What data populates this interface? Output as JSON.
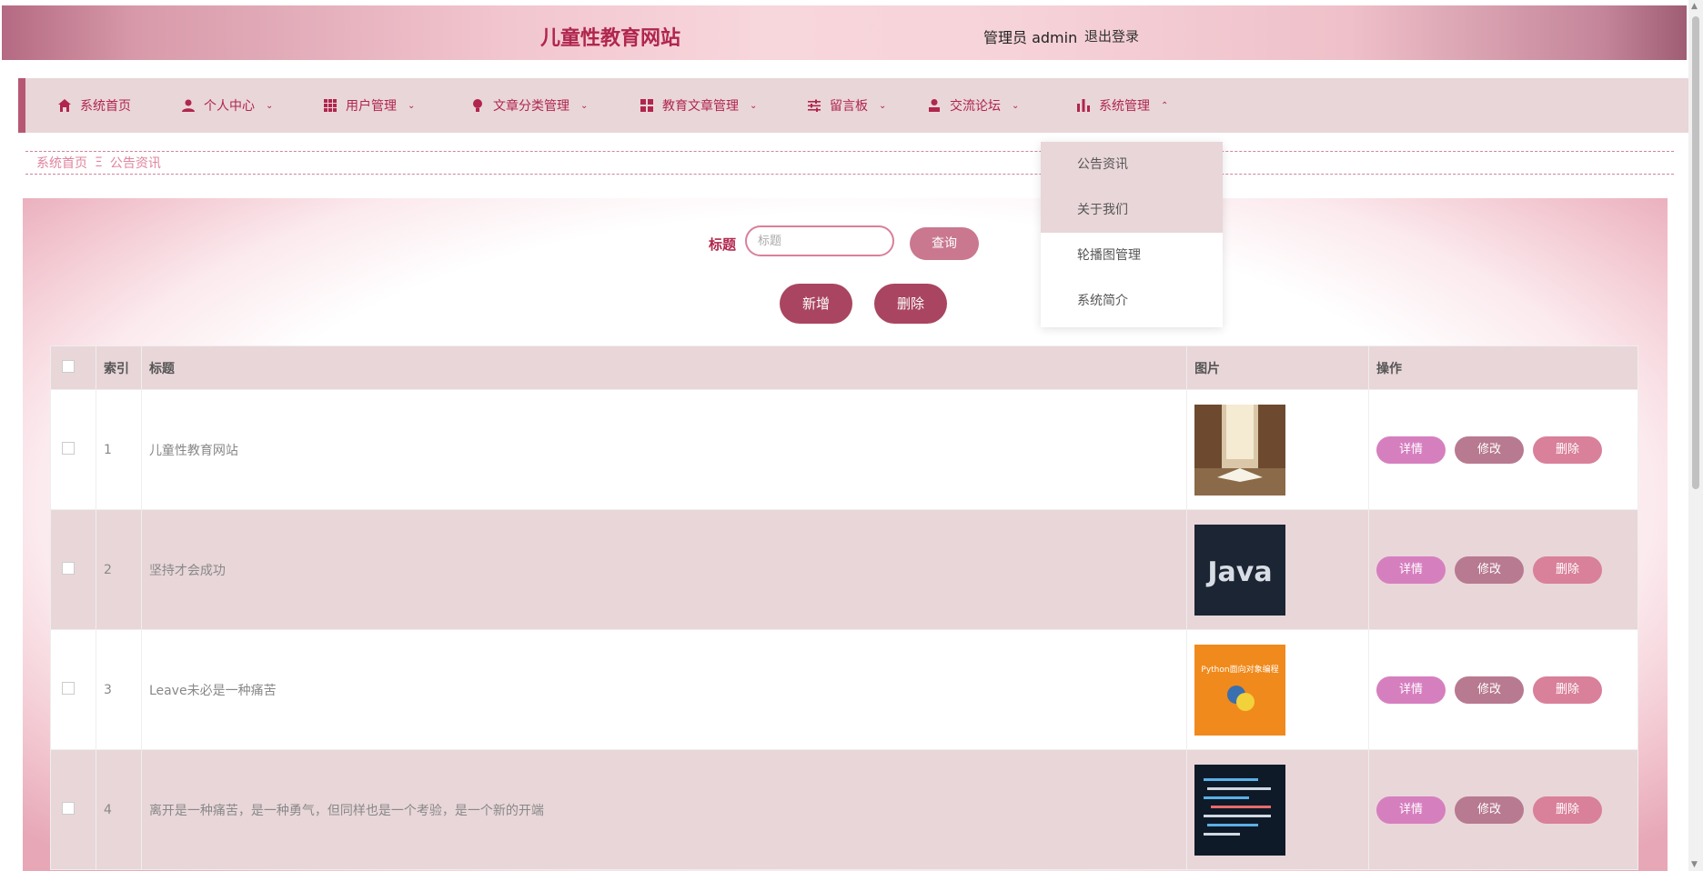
{
  "header": {
    "site_title": "儿童性教育网站",
    "user_label": "管理员 admin",
    "logout_label": "退出登录"
  },
  "nav": {
    "items": [
      {
        "label": "系统首页",
        "icon": "home-icon"
      },
      {
        "label": "个人中心",
        "icon": "user-icon"
      },
      {
        "label": "用户管理",
        "icon": "grid-icon"
      },
      {
        "label": "文章分类管理",
        "icon": "bulb-icon"
      },
      {
        "label": "教育文章管理",
        "icon": "apps-icon"
      },
      {
        "label": "留言板",
        "icon": "sliders-icon"
      },
      {
        "label": "交流论坛",
        "icon": "person-icon"
      },
      {
        "label": "系统管理",
        "icon": "bar-chart-icon"
      }
    ],
    "dropdown": [
      "公告资讯",
      "关于我们",
      "轮播图管理",
      "系统简介"
    ]
  },
  "breadcrumb": {
    "home": "系统首页",
    "separator": "Ξ",
    "current": "公告资讯"
  },
  "search": {
    "label": "标题",
    "placeholder": "标题",
    "query_button": "查询"
  },
  "actions": {
    "add": "新增",
    "delete": "删除"
  },
  "table": {
    "headers": {
      "index": "索引",
      "title": "标题",
      "image": "图片",
      "ops": "操作"
    },
    "rows": [
      {
        "index": "1",
        "title": "儿童性教育网站",
        "image": "library-book-image"
      },
      {
        "index": "2",
        "title": "坚持才会成功",
        "image": "java-image"
      },
      {
        "index": "3",
        "title": "Leave未必是一种痛苦",
        "image": "python-book-image",
        "image_text": "Python面向对象编程"
      },
      {
        "index": "4",
        "title": "离开是一种痛苦，是一种勇气，但同样也是一个考验，是一个新的开端",
        "image": "code-screen-image"
      }
    ],
    "op_labels": {
      "detail": "详情",
      "edit": "修改",
      "remove": "删除"
    }
  },
  "colors": {
    "accent": "#b0264d",
    "nav_bg": "#e9d6d9",
    "button_dark": "#a94560",
    "button_detail": "#d67fbf",
    "button_edit": "#b87a90",
    "button_remove": "#d9809a"
  }
}
